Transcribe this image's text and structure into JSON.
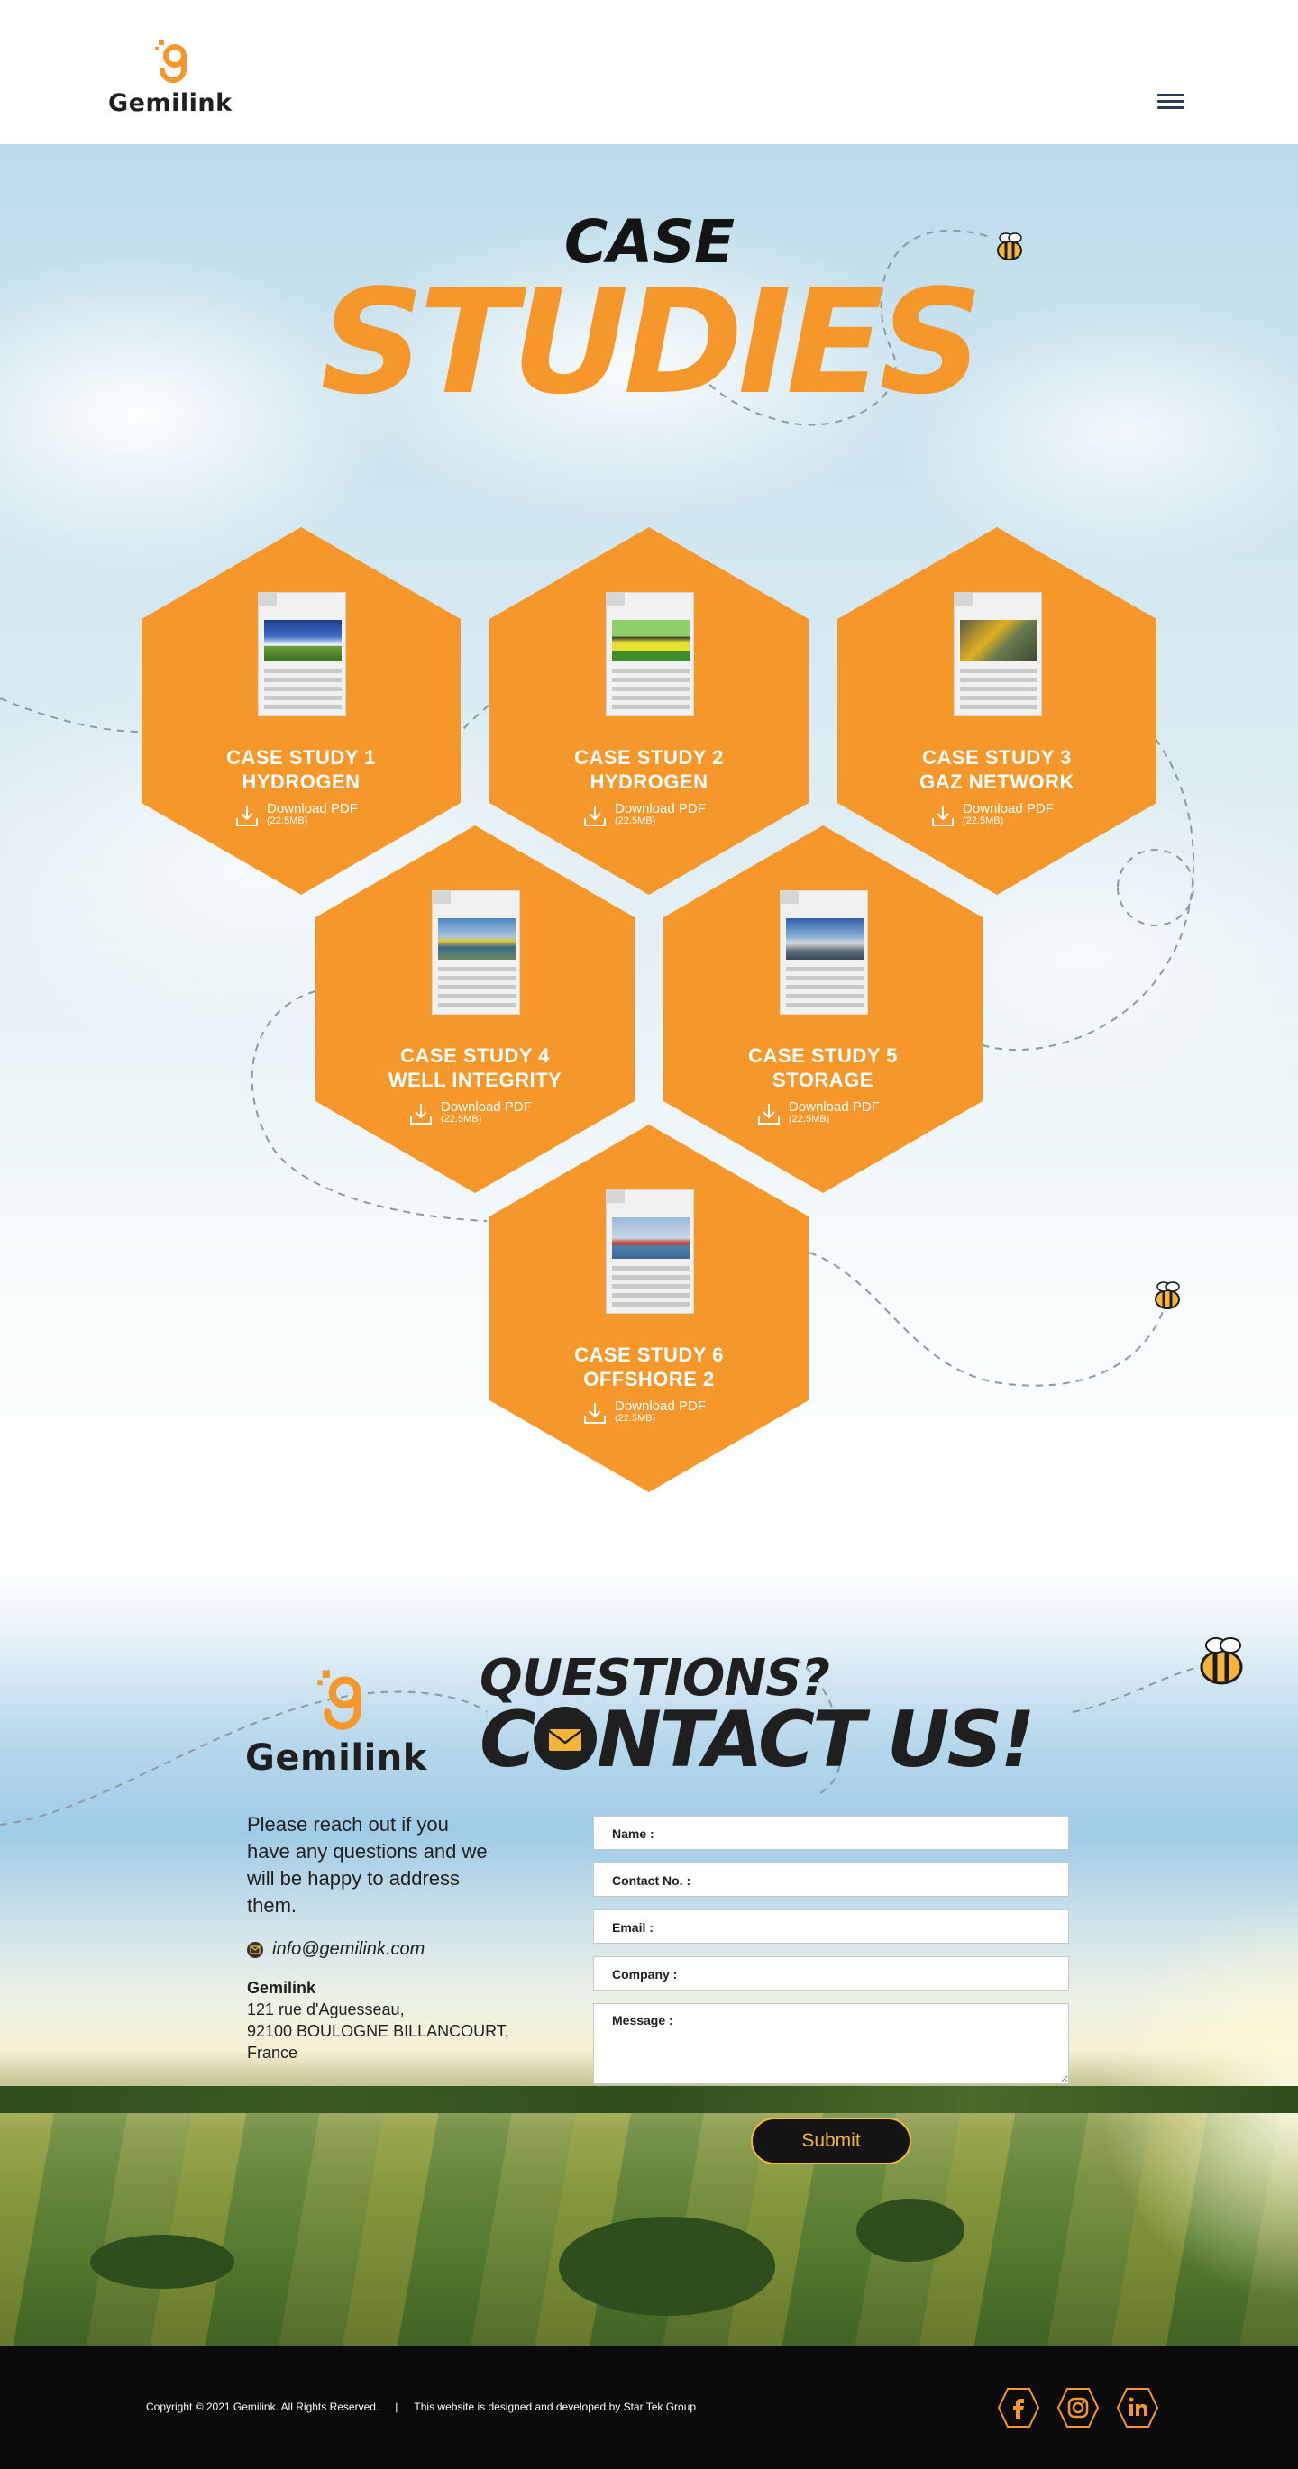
{
  "header": {
    "logo_text": "Gemilink",
    "menu_icon": "hamburger-icon"
  },
  "hero": {
    "title_top": "CASE",
    "title_main": "STUDIES"
  },
  "case_studies": [
    {
      "line1": "CASE STUDY 1",
      "line2": "HYDROGEN",
      "download": "Download PDF",
      "size": "(22.5MB)"
    },
    {
      "line1": "CASE STUDY 2",
      "line2": "HYDROGEN",
      "download": "Download PDF",
      "size": "(22.5MB)"
    },
    {
      "line1": "CASE STUDY 3",
      "line2": "GAZ NETWORK",
      "download": "Download PDF",
      "size": "(22.5MB)"
    },
    {
      "line1": "CASE STUDY 4",
      "line2": "WELL INTEGRITY",
      "download": "Download PDF",
      "size": "(22.5MB)"
    },
    {
      "line1": "CASE STUDY 5",
      "line2": "STORAGE",
      "download": "Download PDF",
      "size": "(22.5MB)"
    },
    {
      "line1": "CASE STUDY 6",
      "line2": "OFFSHORE 2",
      "download": "Download PDF",
      "size": "(22.5MB)"
    }
  ],
  "contact": {
    "logo_text": "Gemilink",
    "questions": "QUESTIONS?",
    "contact_c": "C",
    "contact_rest": "NTACT US!",
    "intro": "Please reach out if you have any questions and we will be happy to address them.",
    "email": "info@gemilink.com",
    "company": "Gemilink",
    "address_lines": [
      "121 rue d'Aguesseau,",
      "92100 BOULOGNE BILLANCOURT,",
      "France"
    ],
    "form": {
      "name_label": "Name :",
      "contact_label": "Contact No. :",
      "email_label": "Email :",
      "company_label": "Company :",
      "message_label": "Message :",
      "name_value": "",
      "contact_value": "",
      "email_value": "",
      "company_value": "",
      "message_value": "",
      "submit_label": "Submit"
    }
  },
  "footer": {
    "copyright": "Copyright © 2021 Gemilink. All Rights Reserved.",
    "separator": "|",
    "credit": "This website is designed and developed by Star Tek Group",
    "social_icons": [
      "facebook-icon",
      "instagram-icon",
      "linkedin-icon"
    ]
  },
  "colors": {
    "accent": "#f5972a",
    "dark": "#1f1f1f",
    "footer_bg": "#0a0a0a",
    "button_text": "#f5b43a"
  }
}
